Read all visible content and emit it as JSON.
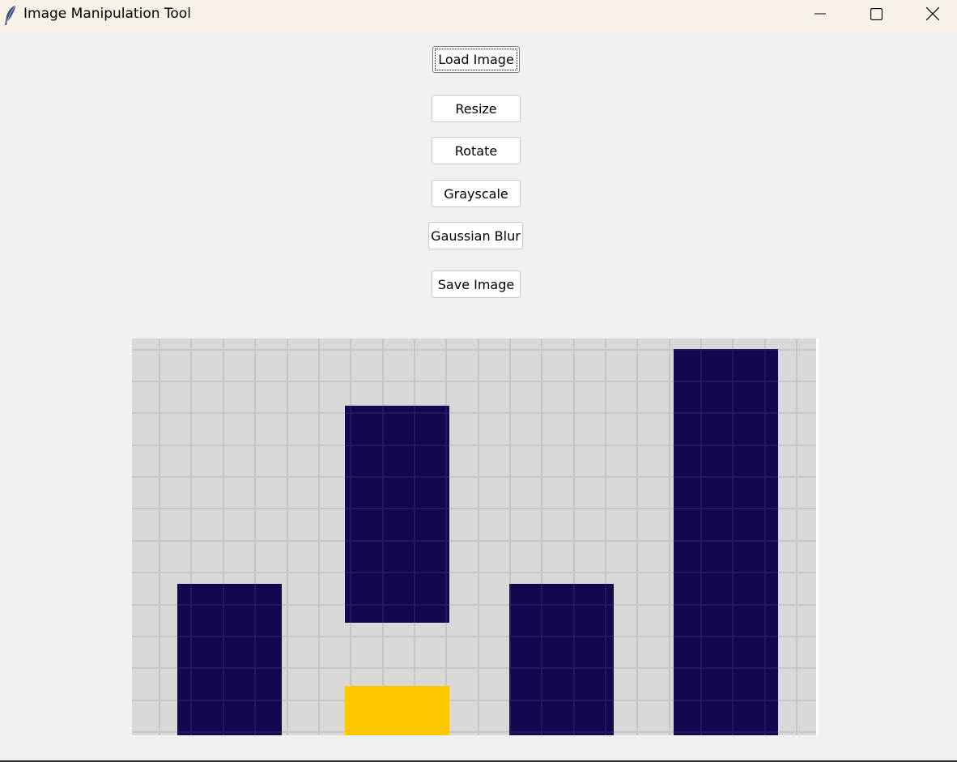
{
  "window": {
    "title": "Image Manipulation Tool",
    "icon": "feather-icon",
    "controls": [
      "minimize-icon",
      "maximize-icon",
      "close-icon"
    ]
  },
  "buttons": {
    "load_image": "Load Image",
    "resize": "Resize",
    "rotate": "Rotate",
    "grayscale": "Grayscale",
    "gaussian_blur": "Gaussian Blur",
    "save_image": "Save Image"
  },
  "image": {
    "description_colors": {
      "background": "#d8d8d8",
      "grid_line": "#c6c6c6",
      "dark_block": "#130850",
      "yellow_block": "#ffc800"
    }
  }
}
